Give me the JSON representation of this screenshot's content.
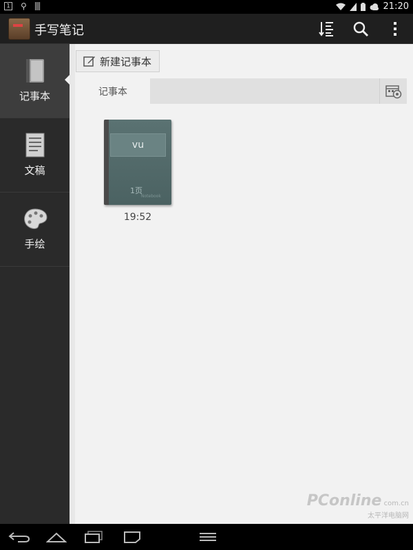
{
  "status_bar": {
    "left_icons": [
      "notification-box-icon",
      "usb-icon",
      "bars-icon"
    ],
    "notification_badge": "1",
    "right_icons": [
      "wifi-icon",
      "signal-icon",
      "battery-icon",
      "cloud-icon"
    ],
    "time": "21:20"
  },
  "action_bar": {
    "app_icon": "app-notebook-icon",
    "title": "手写笔记",
    "actions": [
      "sort-icon",
      "search-icon",
      "overflow-menu-icon"
    ]
  },
  "sidebar": {
    "items": [
      {
        "label": "记事本",
        "icon": "notebook-icon",
        "active": true
      },
      {
        "label": "文稿",
        "icon": "document-icon",
        "active": false
      },
      {
        "label": "手绘",
        "icon": "palette-icon",
        "active": false
      }
    ]
  },
  "content": {
    "new_note_button": "新建记事本",
    "tabs": [
      {
        "label": "记事本",
        "active": true
      }
    ],
    "tab_settings_icon": "calendar-settings-icon",
    "notebooks": [
      {
        "title": "vu",
        "pages": "1页",
        "brand": "Notebook",
        "time": "19:52",
        "cover_color": "#526a6a"
      }
    ]
  },
  "watermark": {
    "logo": "PConline",
    "domain": "com.cn",
    "text": "太平洋电脑网"
  },
  "nav_bar": {
    "buttons": [
      "back-icon",
      "home-icon",
      "recent-apps-icon",
      "screenshot-icon",
      "menu-icon"
    ]
  }
}
